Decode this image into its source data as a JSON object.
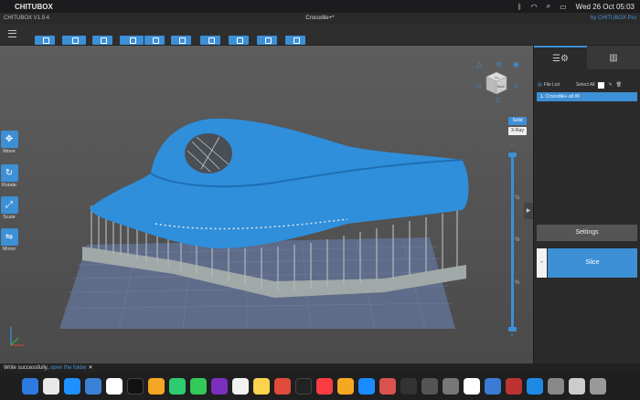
{
  "menubar": {
    "app": "CHITUBOX",
    "datetime": "Wed 26 Oct  05:03"
  },
  "titlebar": {
    "version": "CHITUBOX V1.9.4",
    "title": "Crocodile+*",
    "by": "by CHITUBOX Pro"
  },
  "tools": [
    {
      "label": "Move",
      "icon": "move-icon"
    },
    {
      "label": "Rotate",
      "icon": "rotate-icon"
    },
    {
      "label": "Scale",
      "icon": "scale-icon"
    },
    {
      "label": "Mirror",
      "icon": "mirror-icon"
    }
  ],
  "view": {
    "solid": "Solid",
    "xray": "X-Ray",
    "cube_top": "Top",
    "cube_front": "Back"
  },
  "slider_ticks": [
    "¼",
    "½",
    "¾"
  ],
  "panel": {
    "file_list": "File List",
    "select_all": "Select All",
    "file_item": "1. Crocodile+.stl #0",
    "settings": "Settings",
    "slice": "Slice",
    "dash": "-"
  },
  "status": {
    "message": "Write successfully,",
    "link": "open the folder",
    "close": "✕"
  },
  "colors": {
    "accent": "#3d8fd6",
    "model": "#2f8fdb",
    "supports": "#a8b0b0",
    "plate": "#5a6a8a"
  }
}
